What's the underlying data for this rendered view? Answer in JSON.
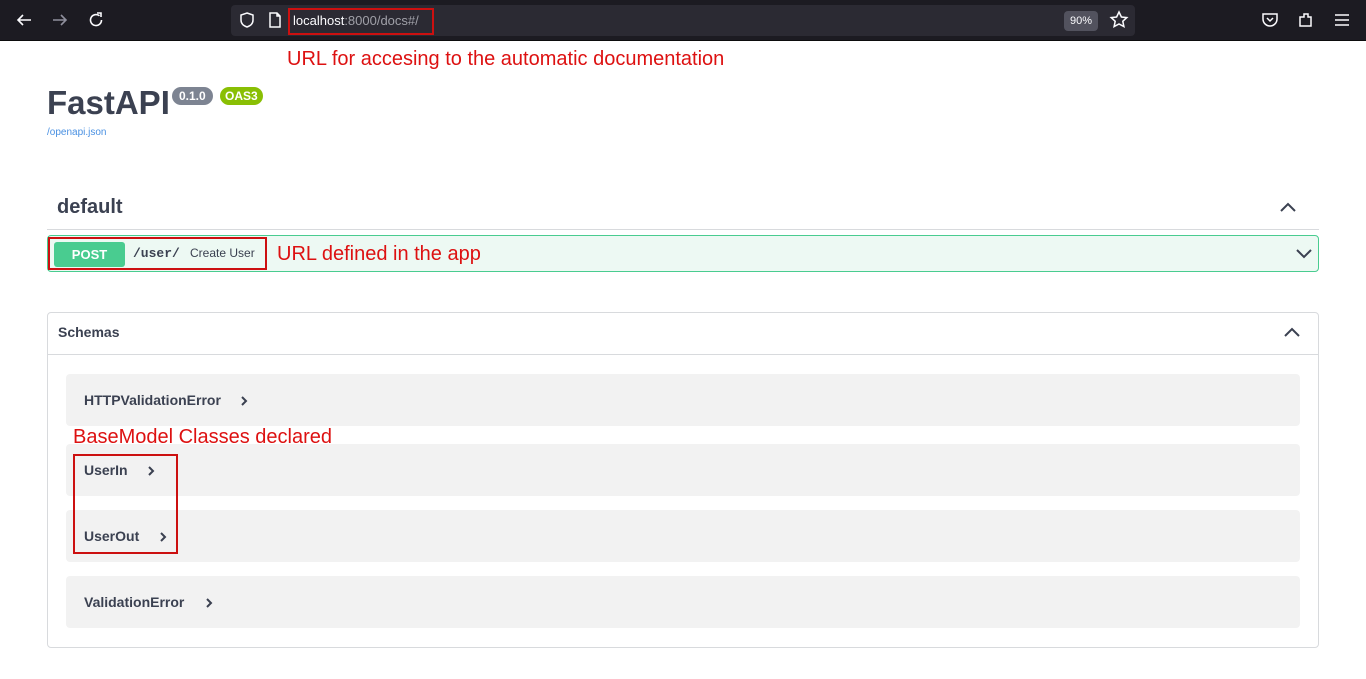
{
  "browser": {
    "url_host": "localhost",
    "url_rest": ":8000/docs#/",
    "zoom": "90%"
  },
  "app": {
    "title": "FastAPI",
    "version": "0.1.0",
    "oas": "OAS3",
    "openapi_link": "/openapi.json"
  },
  "sections": {
    "default_title": "default"
  },
  "operation": {
    "method": "POST",
    "path": "/user/",
    "summary": "Create User"
  },
  "schemas": {
    "title": "Schemas",
    "models": [
      "HTTPValidationError",
      "UserIn",
      "UserOut",
      "ValidationError"
    ]
  },
  "annotations": {
    "url_note": "URL for accesing to the automatic documentation",
    "endpoint_note": "URL defined in the app",
    "models_note": "BaseModel Classes declared"
  },
  "colors": {
    "post": "#49cc90",
    "annotation": "#dd1111",
    "version_badge": "#7d8492",
    "oas_badge": "#89bf04"
  }
}
